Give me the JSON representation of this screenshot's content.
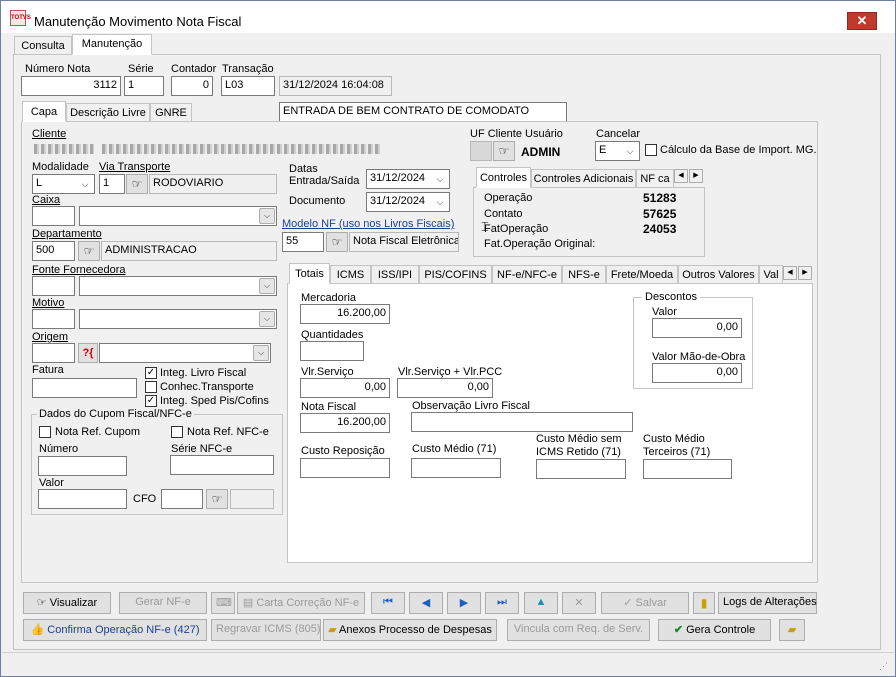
{
  "window": {
    "title": "Manutenção Movimento Nota Fiscal",
    "close": "✕"
  },
  "main_tabs": [
    "Consulta",
    "Manutenção"
  ],
  "header": {
    "numero_label": "Número Nota",
    "numero": "3112",
    "serie_label": "Série",
    "serie": "1",
    "contador_label": "Contador",
    "contador": "0",
    "transacao_label": "Transação",
    "transacao": "L03",
    "datetime": "31/12/2024 16:04:08",
    "transacao_desc": "ENTRADA DE BEM CONTRATO DE COMODATO"
  },
  "sub_tabs": [
    "Capa",
    "Descrição Livre",
    "GNRE"
  ],
  "capa": {
    "cliente_label": "Cliente",
    "modalidade_label": "Modalidade",
    "modalidade": "L",
    "via_label": "Via Transporte",
    "via_code": "1",
    "via_desc": "RODOVIARIO",
    "caixa_label": "Caixa",
    "depto_label": "Departamento",
    "depto_code": "500",
    "depto_desc": "ADMINISTRACAO",
    "fonte_label": "Fonte Fornecedora",
    "motivo_label": "Motivo",
    "origem_label": "Origem",
    "fatura_label": "Fatura",
    "integ_livro": "Integ. Livro Fiscal",
    "conhec": "Conhec.Transporte",
    "integ_sped": "Integ. Sped Pis/Cofins",
    "datas_label": "Datas",
    "entrada_label": "Entrada/Saída",
    "entrada": "31/12/2024",
    "documento_label": "Documento",
    "documento": "31/12/2024",
    "modelo_label": "Modelo NF (uso nos Livros Fiscais)",
    "modelo_code": "55",
    "modelo_desc": "Nota Fiscal Eletrônica",
    "uf_label": "UF Cliente Usuário",
    "usuario": "ADMIN",
    "cancelar_label": "Cancelar",
    "cancelar": "E",
    "calculo_label": "Cálculo da Base de Import. MG."
  },
  "cupom": {
    "title": "Dados do Cupom Fiscal/NFC-e",
    "nota_ref_cupom": "Nota Ref. Cupom",
    "nota_ref_nfce": "Nota Ref. NFC-e",
    "numero_label": "Número",
    "serie_label": "Série NFC-e",
    "valor_label": "Valor",
    "cfo_label": "CFO"
  },
  "controles": {
    "tabs": [
      "Controles",
      "Controles Adicionais",
      "NF ca"
    ],
    "operacao_label": "Operação",
    "operacao": "51283",
    "contato_label": "Contato",
    "contato": "57625",
    "fatoperacao_label": "FatOperação",
    "fatoperacao": "24053",
    "fatorig_label": "Fat.Operação Original:"
  },
  "totais": {
    "tabs": [
      "Totais",
      "ICMS",
      "ISS/IPI",
      "PIS/COFINS",
      "NF-e/NFC-e",
      "NFS-e",
      "Frete/Moeda",
      "Outros Valores",
      "Val"
    ],
    "mercadoria_label": "Mercadoria",
    "mercadoria": "16.200,00",
    "quantidades_label": "Quantidades",
    "vlr_servico_label": "Vlr.Serviço",
    "vlr_servico": "0,00",
    "vlr_pcc_label": "Vlr.Serviço + Vlr.PCC",
    "vlr_pcc": "0,00",
    "nota_fiscal_label": "Nota Fiscal",
    "nota_fiscal": "16.200,00",
    "obs_label": "Observação Livro Fiscal",
    "custo_rep_label": "Custo Reposição",
    "custo_medio_label": "Custo Médio (71)",
    "custo_sem_icms_label1": "Custo Médio sem",
    "custo_sem_icms_label2": "ICMS Retido (71)",
    "custo_terc_label1": "Custo Médio",
    "custo_terc_label2": "Terceiros (71)",
    "descontos_label": "Descontos",
    "valor_label": "Valor",
    "valor": "0,00",
    "mao_obra_label": "Valor Mão-de-Obra",
    "mao_obra": "0,00"
  },
  "buttons": {
    "visualizar": "Visualizar",
    "gerar_nfe": "Gerar NF-e",
    "carta": "Carta Correção NF-e",
    "salvar": "Salvar",
    "logs": "Logs de Alterações",
    "confirma": "Confirma Operação NF-e (427)",
    "regravar": "Regravar ICMS (805)",
    "anexos": "Anexos Processo de Despesas",
    "vincula": "Vincula com Req. de Serv.",
    "gera_controle": "Gera Controle"
  },
  "colors": {
    "close": "#c0392b",
    "link_blue": "#1c3f94",
    "green_check": "#1a8a2a"
  }
}
